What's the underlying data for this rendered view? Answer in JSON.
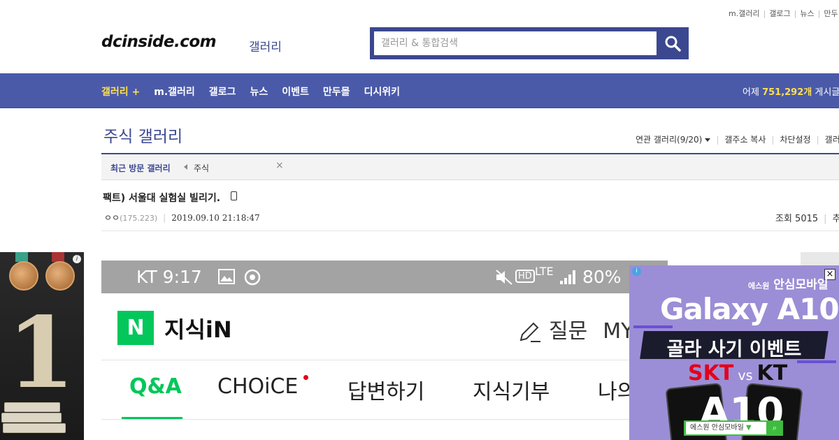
{
  "top_links": [
    "m.갤러리",
    "갤로그",
    "뉴스",
    "만두"
  ],
  "logo": {
    "text": "dcinside.com",
    "sub": "갤러리"
  },
  "search": {
    "placeholder": "갤러리 & 통합검색"
  },
  "nav": {
    "items": [
      "갤러리 +",
      "m.갤러리",
      "갤로그",
      "뉴스",
      "이벤트",
      "만두몰",
      "디시위키"
    ],
    "stats_prefix": "어제",
    "stats_value": "751,292개",
    "stats_suffix": "게시글"
  },
  "gallery": {
    "title": "주식 갤러리",
    "related": "연관 갤러리(9/20)",
    "copy_address": "갤주소 복사",
    "block_settings": "차단설정",
    "more": "갤러"
  },
  "recent": {
    "label": "최근 방문 갤러리",
    "item": "주식",
    "close": "×"
  },
  "post": {
    "title": "팩트) 서울대 실험실 빌리기.",
    "author": "ㅇㅇ",
    "ip": "(175.223)",
    "date": "2019.09.10 21:18:47",
    "views": "조회 5015",
    "recommend": "추"
  },
  "image": {
    "status_left": "KT 9:17",
    "status_right": "80%",
    "lte": "LTE",
    "hd": "HD",
    "n_logo": "N",
    "kin_title": "지식iN",
    "ask": "질문",
    "my": "MY",
    "tabs": [
      "Q&A",
      "CHOiCE",
      "답변하기",
      "지식기부",
      "나의"
    ]
  },
  "left_ad": {
    "number": "1",
    "info": "i"
  },
  "right_ad": {
    "brand_small": "에스원",
    "brand": "안심모바일",
    "model": "Galaxy A10",
    "event": "골라 사기 이벤트",
    "skt": "SKT",
    "vs": "vs",
    "kt": "KT",
    "phone_text": "A10",
    "search_text": "에스원 안심모바일",
    "info": "i",
    "close": "×"
  },
  "colors": {
    "brand_blue": "#3b4890",
    "nav_blue": "#4a5aa8",
    "highlight_yellow": "#ffe04b",
    "naver_green": "#03c75a"
  }
}
